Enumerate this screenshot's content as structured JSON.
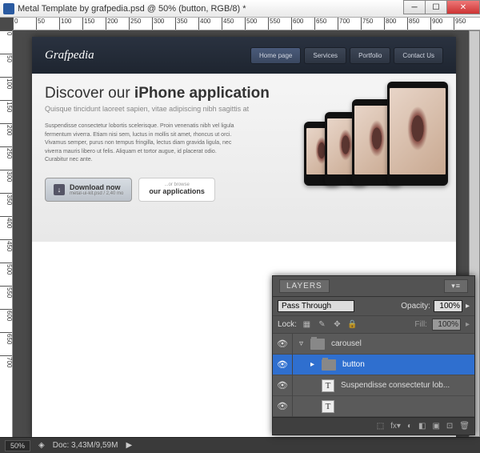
{
  "window": {
    "title": "Metal Template by grafpedia.psd @ 50% (button, RGB/8) *",
    "min": "─",
    "max": "☐",
    "close": "✕"
  },
  "ruler_h": [
    "0",
    "50",
    "100",
    "150",
    "200",
    "250",
    "300",
    "350",
    "400",
    "450",
    "500",
    "550",
    "600",
    "650",
    "700",
    "750",
    "800",
    "850",
    "900",
    "950"
  ],
  "ruler_v": [
    "0",
    "50",
    "100",
    "150",
    "200",
    "250",
    "300",
    "350",
    "400",
    "450",
    "500",
    "550",
    "600",
    "650",
    "700"
  ],
  "page": {
    "logo": "Grafpedia",
    "nav": [
      {
        "label": "Home page",
        "active": true
      },
      {
        "label": "Services",
        "active": false
      },
      {
        "label": "Portfolio",
        "active": false
      },
      {
        "label": "Contact Us",
        "active": false
      }
    ],
    "headline_a": "Discover our ",
    "headline_b": "iPhone application",
    "subhead": "Quisque tincidunt laoreet sapien, vitae adipiscing nibh sagittis at",
    "body": "Suspendisse consectetur lobortis scelerisque. Proin venenatis nibh vel ligula fermentum viverra. Etiam nisi sem, luctus in mollis sit amet, rhoncus ut orci. Vivamus semper, purus non tempus fringilla, lectus diam gravida ligula, nec viverra mauris libero ut felis. Aliquam et tortor augue, id placerat odio. Curabitur nec ante.",
    "dl_icon": "↓",
    "dl_label": "Download now",
    "dl_sub": "metal-ui-kit.psd / 2,40 mo",
    "app_sub": "...or browse",
    "app_label": "our applications"
  },
  "status": {
    "zoom": "50%",
    "doc": "Doc: 3,43M/9,59M",
    "play": "▶"
  },
  "layers": {
    "title": "LAYERS",
    "menu": "▾≡",
    "blend": "Pass Through",
    "opacity_label": "Opacity:",
    "opacity": "100%",
    "lock_label": "Lock:",
    "fill_label": "Fill:",
    "fill": "100%",
    "rows": [
      {
        "eye": "👁",
        "arrow": "▿",
        "type": "folder",
        "name": "carousel",
        "sel": false,
        "indent": 0
      },
      {
        "eye": "👁",
        "arrow": "▸",
        "type": "folder",
        "name": "button",
        "sel": true,
        "indent": 1
      },
      {
        "eye": "👁",
        "arrow": "",
        "type": "text",
        "name": "Suspendisse consectetur lob...",
        "sel": false,
        "indent": 1
      },
      {
        "eye": "👁",
        "arrow": "",
        "type": "text",
        "name": "",
        "sel": false,
        "indent": 1
      }
    ],
    "foot_icons": [
      "⬚",
      "fx▾",
      "◐",
      "◧",
      "▣",
      "⊡",
      "🗑"
    ]
  }
}
